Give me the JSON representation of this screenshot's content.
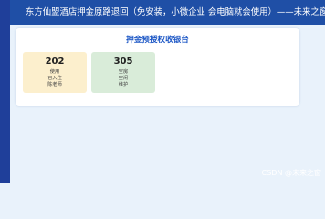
{
  "header": {
    "title": "东方仙盟酒店押金原路退回（免安装，小微企业 会电脑就会使用）——未来之窗"
  },
  "main": {
    "title": "押金预授权收银台"
  },
  "rooms": [
    {
      "number": "202",
      "line1": "使用",
      "line2": "已入住",
      "line3": "陈老师"
    },
    {
      "number": "305",
      "line1": "空房",
      "line2": "空闲",
      "line3": "维护"
    }
  ],
  "watermark": "CSDN @未来之窗"
}
